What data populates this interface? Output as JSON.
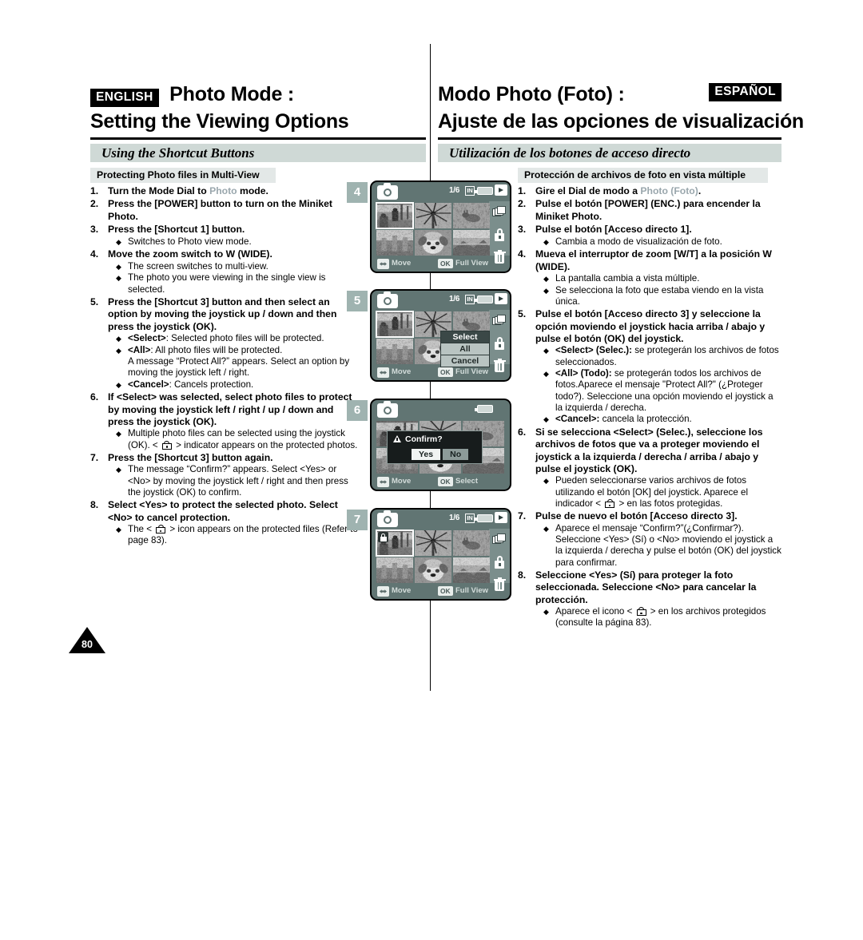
{
  "header": {
    "en": {
      "lang": "ENGLISH",
      "title": "Photo Mode :",
      "subtitle": "Setting the Viewing Options",
      "band": "Using the Shortcut Buttons",
      "section": "Protecting Photo files in Multi-View"
    },
    "es": {
      "lang": "ESPAÑOL",
      "title": "Modo Photo (Foto) :",
      "subtitle": "Ajuste de las opciones de visualización",
      "band": "Utilización de los botones de acceso directo",
      "section": "Protección de archivos de foto en vista múltiple"
    }
  },
  "page_number": "80",
  "steps_en": [
    {
      "num": "1.",
      "title_pre": "Turn the Mode Dial to ",
      "title_grey": "Photo",
      "title_post": " mode.",
      "bullets": []
    },
    {
      "num": "2.",
      "title": "Press the [POWER] button to turn on the Miniket Photo.",
      "bullets": []
    },
    {
      "num": "3.",
      "title": "Press the [Shortcut 1] button.",
      "bullets": [
        "Switches to Photo view mode."
      ]
    },
    {
      "num": "4.",
      "title": "Move the zoom switch to W (WIDE).",
      "bullets": [
        "The screen switches to multi-view.",
        "The photo you were viewing in the single view is selected."
      ]
    },
    {
      "num": "5.",
      "title": "Press the [Shortcut 3] button and then select an option by moving the joystick up / down and then press the joystick (OK).",
      "bullets_rich": [
        "<b>&lt;Select&gt;</b>: Selected photo files will be protected.",
        "<b>&lt;All&gt;</b>: All photo files will be protected.<br>A message “Protect All?” appears. Select an option by moving the joystick left / right.",
        "<b>&lt;Cancel&gt;</b>: Cancels protection."
      ]
    },
    {
      "num": "6.",
      "title": "If <Select> was selected, select photo files to protect by moving the joystick left / right / up / down and press the joystick (OK).",
      "bullets_rich": [
        "Multiple photo files can be selected using the joystick (OK). &lt; [LOCK] &gt; indicator appears on the protected photos."
      ]
    },
    {
      "num": "7.",
      "title": "Press the [Shortcut 3] button again.",
      "bullets": [
        "The message “Confirm?” appears. Select <Yes> or <No> by moving the joystick left / right and then press the joystick (OK) to confirm."
      ]
    },
    {
      "num": "8.",
      "title": "Select <Yes> to protect the selected photo. Select <No> to cancel protection.",
      "bullets_rich": [
        "The &lt; [LOCK] &gt; icon appears on the protected files (Refer to page 83)."
      ]
    }
  ],
  "steps_es": [
    {
      "num": "1.",
      "title_pre": "Gire el Dial de modo a ",
      "title_grey": "Photo (Foto)",
      "title_post": ".",
      "bullets": []
    },
    {
      "num": "2.",
      "title": "Pulse el botón [POWER] (ENC.) para encender la Miniket Photo.",
      "bullets": []
    },
    {
      "num": "3.",
      "title": "Pulse el botón [Acceso directo 1].",
      "bullets": [
        "Cambia a modo de visualización de foto."
      ]
    },
    {
      "num": "4.",
      "title": "Mueva el interruptor de zoom [W/T] a la posición W (WIDE).",
      "bullets": [
        "La pantalla cambia a vista múltiple.",
        "Se selecciona la foto que estaba viendo en la vista única."
      ]
    },
    {
      "num": "5.",
      "title": "Pulse el botón [Acceso directo 3] y seleccione la opción moviendo el joystick hacia arriba / abajo y pulse el botón (OK) del joystick.",
      "bullets_rich": [
        "<b>&lt;Select&gt; (Selec.):</b> se protegerán los archivos de fotos seleccionados.",
        "<b>&lt;All&gt; (Todo):</b> se protegerán todos los archivos de fotos.Aparece el mensaje \"Protect All?\" (¿Proteger todo?). Seleccione una opción moviendo el joystick a la izquierda / derecha.",
        "<b>&lt;Cancel&gt;:</b> cancela la protección."
      ]
    },
    {
      "num": "6.",
      "title": "Si se selecciona <Select> (Selec.), seleccione los archivos de fotos que va a proteger moviendo el joystick a la izquierda / derecha / arriba / abajo y pulse el joystick (OK).",
      "bullets_rich": [
        "Pueden seleccionarse varios archivos de fotos utilizando el botón [OK] del joystick. Aparece el indicador &lt; [LOCK] &gt; en las fotos protegidas."
      ]
    },
    {
      "num": "7.",
      "title": "Pulse de nuevo el botón [Acceso directo 3].",
      "bullets": [
        "Aparece el mensaje “Confirm?”(¿Confirmar?). Seleccione <Yes> (Sí) o <No> moviendo el joystick a la izquierda / derecha y pulse el botón (OK) del joystick para confirmar."
      ]
    },
    {
      "num": "8.",
      "title": "Seleccione <Yes> (Sí) para proteger la foto seleccionada. Seleccione <No> para cancelar la protección.",
      "bullets_rich": [
        "Aparece el icono &lt; [LOCK] &gt; en los archivos protegidos (consulte la página 83)."
      ]
    }
  ],
  "screens": [
    {
      "step_badge": "4",
      "top": {
        "counter": "1/6",
        "storage": "IN"
      },
      "bottom": {
        "move_label": "Move",
        "ok_key": "OK",
        "ok_label": "Full View"
      },
      "selected_cell": 0,
      "menu": null,
      "confirm": null,
      "locked_cells": []
    },
    {
      "step_badge": "5",
      "top": {
        "counter": "1/6",
        "storage": "IN"
      },
      "bottom": {
        "move_label": "Move",
        "ok_key": "OK",
        "ok_label": "Full View"
      },
      "selected_cell": 0,
      "menu": {
        "items": [
          "Select",
          "All",
          "Cancel"
        ],
        "active": 0
      },
      "confirm": null,
      "locked_cells": []
    },
    {
      "step_badge": "6",
      "top": {
        "counter": "",
        "storage": ""
      },
      "bottom": {
        "move_label": "Move",
        "ok_key": "OK",
        "ok_label": "Select"
      },
      "selected_cell": -1,
      "menu": null,
      "confirm": {
        "title": "Confirm?",
        "yes": "Yes",
        "no": "No",
        "active": "yes"
      },
      "locked_cells": []
    },
    {
      "step_badge": "7",
      "top": {
        "counter": "1/6",
        "storage": "IN"
      },
      "bottom": {
        "move_label": "Move",
        "ok_key": "OK",
        "ok_label": "Full View"
      },
      "selected_cell": 0,
      "menu": null,
      "confirm": null,
      "locked_cells": [
        0
      ]
    }
  ],
  "thumbnails": [
    "boy-palm-street",
    "palm-tree-sky",
    "rabbit-grass",
    "city-buildings",
    "shih-tzu-dog",
    "coastline-cliff"
  ],
  "colors": {
    "band": "#cfd9d6",
    "subband": "#e3e8e7",
    "lcd_bg": "#617573",
    "lcd_rail": "#7b8e8c",
    "badge": "#9fb3b0",
    "grey_text": "#9aa7ad"
  }
}
